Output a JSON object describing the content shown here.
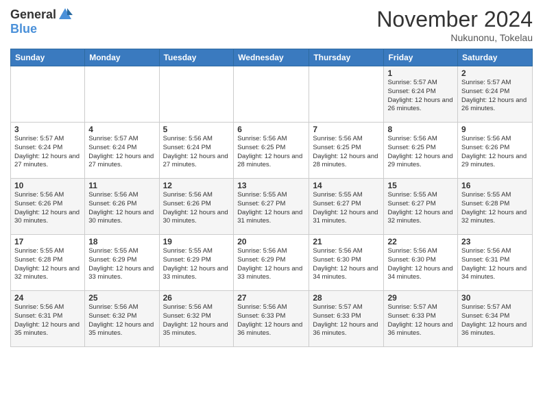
{
  "header": {
    "logo_general": "General",
    "logo_blue": "Blue",
    "title": "November 2024",
    "location": "Nukunonu, Tokelau"
  },
  "calendar": {
    "columns": [
      "Sunday",
      "Monday",
      "Tuesday",
      "Wednesday",
      "Thursday",
      "Friday",
      "Saturday"
    ],
    "weeks": [
      [
        {
          "day": "",
          "info": ""
        },
        {
          "day": "",
          "info": ""
        },
        {
          "day": "",
          "info": ""
        },
        {
          "day": "",
          "info": ""
        },
        {
          "day": "",
          "info": ""
        },
        {
          "day": "1",
          "info": "Sunrise: 5:57 AM\nSunset: 6:24 PM\nDaylight: 12 hours\nand 26 minutes."
        },
        {
          "day": "2",
          "info": "Sunrise: 5:57 AM\nSunset: 6:24 PM\nDaylight: 12 hours\nand 26 minutes."
        }
      ],
      [
        {
          "day": "3",
          "info": "Sunrise: 5:57 AM\nSunset: 6:24 PM\nDaylight: 12 hours\nand 27 minutes."
        },
        {
          "day": "4",
          "info": "Sunrise: 5:57 AM\nSunset: 6:24 PM\nDaylight: 12 hours\nand 27 minutes."
        },
        {
          "day": "5",
          "info": "Sunrise: 5:56 AM\nSunset: 6:24 PM\nDaylight: 12 hours\nand 27 minutes."
        },
        {
          "day": "6",
          "info": "Sunrise: 5:56 AM\nSunset: 6:25 PM\nDaylight: 12 hours\nand 28 minutes."
        },
        {
          "day": "7",
          "info": "Sunrise: 5:56 AM\nSunset: 6:25 PM\nDaylight: 12 hours\nand 28 minutes."
        },
        {
          "day": "8",
          "info": "Sunrise: 5:56 AM\nSunset: 6:25 PM\nDaylight: 12 hours\nand 29 minutes."
        },
        {
          "day": "9",
          "info": "Sunrise: 5:56 AM\nSunset: 6:26 PM\nDaylight: 12 hours\nand 29 minutes."
        }
      ],
      [
        {
          "day": "10",
          "info": "Sunrise: 5:56 AM\nSunset: 6:26 PM\nDaylight: 12 hours\nand 30 minutes."
        },
        {
          "day": "11",
          "info": "Sunrise: 5:56 AM\nSunset: 6:26 PM\nDaylight: 12 hours\nand 30 minutes."
        },
        {
          "day": "12",
          "info": "Sunrise: 5:56 AM\nSunset: 6:26 PM\nDaylight: 12 hours\nand 30 minutes."
        },
        {
          "day": "13",
          "info": "Sunrise: 5:55 AM\nSunset: 6:27 PM\nDaylight: 12 hours\nand 31 minutes."
        },
        {
          "day": "14",
          "info": "Sunrise: 5:55 AM\nSunset: 6:27 PM\nDaylight: 12 hours\nand 31 minutes."
        },
        {
          "day": "15",
          "info": "Sunrise: 5:55 AM\nSunset: 6:27 PM\nDaylight: 12 hours\nand 32 minutes."
        },
        {
          "day": "16",
          "info": "Sunrise: 5:55 AM\nSunset: 6:28 PM\nDaylight: 12 hours\nand 32 minutes."
        }
      ],
      [
        {
          "day": "17",
          "info": "Sunrise: 5:55 AM\nSunset: 6:28 PM\nDaylight: 12 hours\nand 32 minutes."
        },
        {
          "day": "18",
          "info": "Sunrise: 5:55 AM\nSunset: 6:29 PM\nDaylight: 12 hours\nand 33 minutes."
        },
        {
          "day": "19",
          "info": "Sunrise: 5:55 AM\nSunset: 6:29 PM\nDaylight: 12 hours\nand 33 minutes."
        },
        {
          "day": "20",
          "info": "Sunrise: 5:56 AM\nSunset: 6:29 PM\nDaylight: 12 hours\nand 33 minutes."
        },
        {
          "day": "21",
          "info": "Sunrise: 5:56 AM\nSunset: 6:30 PM\nDaylight: 12 hours\nand 34 minutes."
        },
        {
          "day": "22",
          "info": "Sunrise: 5:56 AM\nSunset: 6:30 PM\nDaylight: 12 hours\nand 34 minutes."
        },
        {
          "day": "23",
          "info": "Sunrise: 5:56 AM\nSunset: 6:31 PM\nDaylight: 12 hours\nand 34 minutes."
        }
      ],
      [
        {
          "day": "24",
          "info": "Sunrise: 5:56 AM\nSunset: 6:31 PM\nDaylight: 12 hours\nand 35 minutes."
        },
        {
          "day": "25",
          "info": "Sunrise: 5:56 AM\nSunset: 6:32 PM\nDaylight: 12 hours\nand 35 minutes."
        },
        {
          "day": "26",
          "info": "Sunrise: 5:56 AM\nSunset: 6:32 PM\nDaylight: 12 hours\nand 35 minutes."
        },
        {
          "day": "27",
          "info": "Sunrise: 5:56 AM\nSunset: 6:33 PM\nDaylight: 12 hours\nand 36 minutes."
        },
        {
          "day": "28",
          "info": "Sunrise: 5:57 AM\nSunset: 6:33 PM\nDaylight: 12 hours\nand 36 minutes."
        },
        {
          "day": "29",
          "info": "Sunrise: 5:57 AM\nSunset: 6:33 PM\nDaylight: 12 hours\nand 36 minutes."
        },
        {
          "day": "30",
          "info": "Sunrise: 5:57 AM\nSunset: 6:34 PM\nDaylight: 12 hours\nand 36 minutes."
        }
      ]
    ]
  }
}
